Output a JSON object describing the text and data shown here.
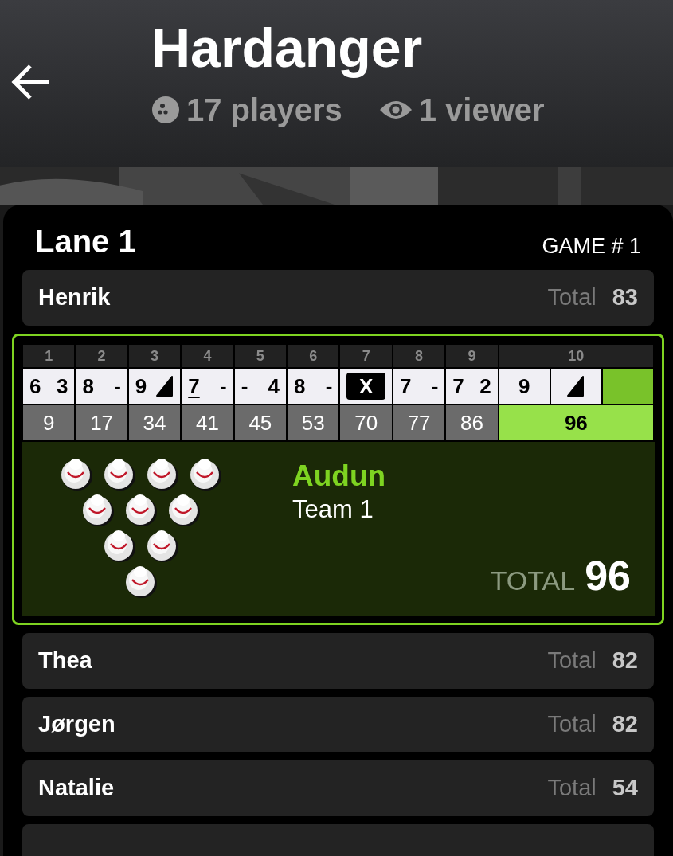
{
  "header": {
    "title": "Hardanger",
    "players": "17 players",
    "viewers": "1 viewer"
  },
  "lane": {
    "title": "Lane 1",
    "game": "GAME # 1"
  },
  "players": [
    {
      "name": "Henrik",
      "total_label": "Total",
      "total": "83",
      "selected": false
    },
    {
      "name": "Audun",
      "team": "Team 1",
      "total_label": "TOTAL",
      "total": "96",
      "selected": true,
      "frames": [
        {
          "number": "1",
          "throws": [
            {
              "kind": "pins",
              "text": "6",
              "split": false
            },
            {
              "kind": "pins",
              "text": "3",
              "split": false
            }
          ],
          "score": "9",
          "current": false
        },
        {
          "number": "2",
          "throws": [
            {
              "kind": "pins",
              "text": "8",
              "split": false
            },
            {
              "kind": "pins",
              "text": "-",
              "split": false
            }
          ],
          "score": "17",
          "current": false
        },
        {
          "number": "3",
          "throws": [
            {
              "kind": "pins",
              "text": "9",
              "split": false
            },
            {
              "kind": "spare"
            }
          ],
          "score": "34",
          "current": false
        },
        {
          "number": "4",
          "throws": [
            {
              "kind": "pins",
              "text": "7",
              "split": true
            },
            {
              "kind": "pins",
              "text": "-",
              "split": false
            }
          ],
          "score": "41",
          "current": false
        },
        {
          "number": "5",
          "throws": [
            {
              "kind": "pins",
              "text": "-",
              "split": false
            },
            {
              "kind": "pins",
              "text": "4",
              "split": false
            }
          ],
          "score": "45",
          "current": false
        },
        {
          "number": "6",
          "throws": [
            {
              "kind": "pins",
              "text": "8",
              "split": false
            },
            {
              "kind": "pins",
              "text": "-",
              "split": false
            }
          ],
          "score": "53",
          "current": false
        },
        {
          "number": "7",
          "throws": [
            {
              "kind": "strike",
              "text": "X"
            }
          ],
          "score": "70",
          "current": false
        },
        {
          "number": "8",
          "throws": [
            {
              "kind": "pins",
              "text": "7",
              "split": false
            },
            {
              "kind": "pins",
              "text": "-",
              "split": false
            }
          ],
          "score": "77",
          "current": false
        },
        {
          "number": "9",
          "throws": [
            {
              "kind": "pins",
              "text": "7",
              "split": false
            },
            {
              "kind": "pins",
              "text": "2",
              "split": false
            }
          ],
          "score": "86",
          "current": false
        },
        {
          "number": "10",
          "throws": [
            {
              "kind": "pins",
              "text": "9",
              "split": false
            },
            {
              "kind": "spare"
            },
            {
              "kind": "pending"
            }
          ],
          "score": "96",
          "current": true
        }
      ],
      "pins": [
        {
          "standing": true
        },
        {
          "standing": true
        },
        {
          "standing": true
        },
        {
          "standing": true
        },
        {
          "standing": true
        },
        {
          "standing": true
        },
        {
          "standing": true
        },
        {
          "standing": true
        },
        {
          "standing": true
        },
        {
          "standing": true
        }
      ]
    },
    {
      "name": "Thea",
      "total_label": "Total",
      "total": "82",
      "selected": false
    },
    {
      "name": "Jørgen",
      "total_label": "Total",
      "total": "82",
      "selected": false
    },
    {
      "name": "Natalie",
      "total_label": "Total",
      "total": "54",
      "selected": false
    }
  ]
}
